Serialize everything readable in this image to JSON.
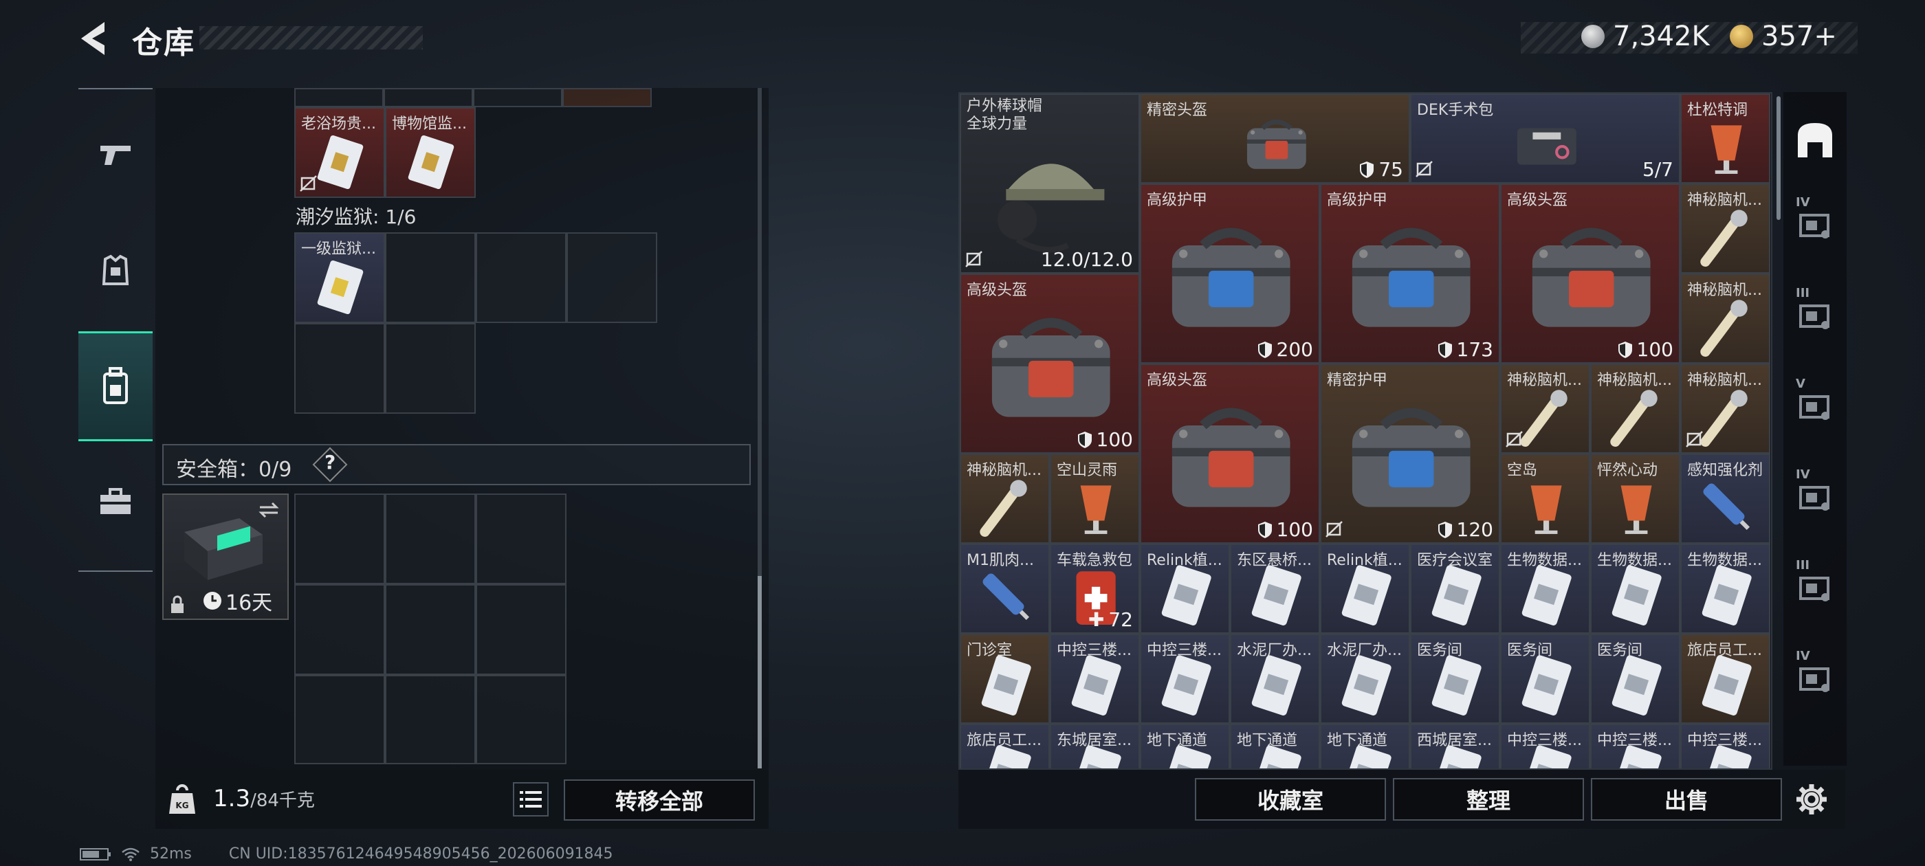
{
  "header": {
    "title": "仓库",
    "currency_silver": "7,342K",
    "currency_gold": "357+"
  },
  "rail": {
    "items": [
      {
        "icon": "gun-icon"
      },
      {
        "icon": "armor-vest-icon"
      },
      {
        "icon": "backpack-icon"
      },
      {
        "icon": "toolbox-icon"
      }
    ]
  },
  "left": {
    "top_items": [
      {
        "name": "老浴场贵...",
        "bg": "red"
      },
      {
        "name": "博物馆监...",
        "bg": "red"
      }
    ],
    "prison_label": "潮汐监狱: 1/6",
    "prison_item": {
      "name": "一级监狱..."
    },
    "safebox_label": "安全箱：0/9",
    "safebox_help": "?",
    "safebox_timer": "16天",
    "weight_value": "1.3",
    "weight_max": "/84千克",
    "transfer_all": "转移全部"
  },
  "stash": {
    "items": [
      {
        "name": "户外棒球帽 全球力量",
        "num": "12.0/12.0",
        "bg": "gray",
        "icon": "cap-headset-icon"
      },
      {
        "name": "精密头盔",
        "num": "75",
        "bg": "brown",
        "icon": "helmet-bag-icon"
      },
      {
        "name": "DEK手术包",
        "num": "5/7",
        "bg": "navy",
        "icon": "surgery-kit-icon"
      },
      {
        "name": "杜松特调",
        "num": "",
        "bg": "red",
        "icon": "drink-icon"
      },
      {
        "name": "高级护甲",
        "num": "200",
        "bg": "red",
        "icon": "armor-bag-icon"
      },
      {
        "name": "高级护甲",
        "num": "173",
        "bg": "red",
        "icon": "armor-bag-icon"
      },
      {
        "name": "高级头盔",
        "num": "100",
        "bg": "red",
        "icon": "helmet-bag-icon"
      },
      {
        "name": "神秘脑机...",
        "num": "",
        "bg": "brown",
        "icon": "brain-chip-icon"
      },
      {
        "name": "高级头盔",
        "num": "100",
        "bg": "red",
        "icon": "helmet-bag-icon"
      },
      {
        "name": "神秘脑机...",
        "num": "",
        "bg": "brown",
        "icon": "brain-chip-icon"
      },
      {
        "name": "高级头盔",
        "num": "100",
        "bg": "red",
        "icon": "helmet-bag-icon"
      },
      {
        "name": "精密护甲",
        "num": "120",
        "bg": "brown",
        "icon": "armor-bag-icon"
      },
      {
        "name": "神秘脑机...",
        "num": "",
        "bg": "brown",
        "icon": "brain-chip-icon"
      },
      {
        "name": "神秘脑机...",
        "num": "",
        "bg": "brown",
        "icon": "brain-chip-icon"
      },
      {
        "name": "神秘脑机...",
        "num": "",
        "bg": "brown",
        "icon": "brain-chip-icon"
      },
      {
        "name": "神秘脑机...",
        "num": "",
        "bg": "brown",
        "icon": "brain-chip-icon"
      },
      {
        "name": "空山灵雨",
        "num": "",
        "bg": "brown",
        "icon": "drink-icon"
      },
      {
        "name": "空岛",
        "num": "",
        "bg": "brown",
        "icon": "drink-icon"
      },
      {
        "name": "怦然心动",
        "num": "",
        "bg": "brown",
        "icon": "drink-icon"
      },
      {
        "name": "感知强化剂",
        "num": "",
        "bg": "navy",
        "icon": "injector-icon"
      },
      {
        "name": "M1肌肉...",
        "num": "",
        "bg": "navy",
        "icon": "injector-icon"
      },
      {
        "name": "车载急救包",
        "num": "72",
        "bg": "navy",
        "icon": "medkit-icon"
      },
      {
        "name": "Relink植...",
        "num": "",
        "bg": "navy",
        "icon": "keycard-icon"
      },
      {
        "name": "东区悬桥...",
        "num": "",
        "bg": "navy",
        "icon": "keycard-icon"
      },
      {
        "name": "Relink植...",
        "num": "",
        "bg": "navy",
        "icon": "keycard-icon"
      },
      {
        "name": "医疗会议室",
        "num": "",
        "bg": "navy",
        "icon": "keycard-icon"
      },
      {
        "name": "生物数据...",
        "num": "",
        "bg": "navy",
        "icon": "keycard-icon"
      },
      {
        "name": "生物数据...",
        "num": "",
        "bg": "navy",
        "icon": "keycard-icon"
      },
      {
        "name": "生物数据...",
        "num": "",
        "bg": "navy",
        "icon": "keycard-icon"
      },
      {
        "name": "门诊室",
        "num": "",
        "bg": "brown",
        "icon": "keycard-icon"
      },
      {
        "name": "中控三楼...",
        "num": "",
        "bg": "navy",
        "icon": "keycard-icon"
      },
      {
        "name": "中控三楼...",
        "num": "",
        "bg": "navy",
        "icon": "keycard-icon"
      },
      {
        "name": "水泥厂办...",
        "num": "",
        "bg": "navy",
        "icon": "keycard-icon"
      },
      {
        "name": "水泥厂办...",
        "num": "",
        "bg": "navy",
        "icon": "keycard-icon"
      },
      {
        "name": "医务间",
        "num": "",
        "bg": "navy",
        "icon": "keycard-icon"
      },
      {
        "name": "医务间",
        "num": "",
        "bg": "navy",
        "icon": "keycard-icon"
      },
      {
        "name": "医务间",
        "num": "",
        "bg": "navy",
        "icon": "keycard-icon"
      },
      {
        "name": "旅店员工...",
        "num": "",
        "bg": "brown",
        "icon": "keycard-icon"
      },
      {
        "name": "旅店员工...",
        "num": "",
        "bg": "navy",
        "icon": "keycard-icon"
      },
      {
        "name": "东城居室...",
        "num": "",
        "bg": "navy",
        "icon": "keycard-icon"
      },
      {
        "name": "地下通道",
        "num": "",
        "bg": "navy",
        "icon": "keycard-icon"
      },
      {
        "name": "地下通道",
        "num": "",
        "bg": "navy",
        "icon": "keycard-icon"
      },
      {
        "name": "地下通道",
        "num": "",
        "bg": "navy",
        "icon": "keycard-icon"
      },
      {
        "name": "西城居室...",
        "num": "",
        "bg": "navy",
        "icon": "keycard-icon"
      },
      {
        "name": "中控三楼...",
        "num": "",
        "bg": "navy",
        "icon": "keycard-icon"
      },
      {
        "name": "中控三楼...",
        "num": "",
        "bg": "navy",
        "icon": "keycard-icon"
      },
      {
        "name": "中控三楼...",
        "num": "",
        "bg": "navy",
        "icon": "keycard-icon"
      }
    ],
    "buttons": {
      "collection": "收藏室",
      "organize": "整理",
      "sell": "出售"
    }
  },
  "right_rail": {
    "tabs": [
      {
        "icon": "stash-home-icon"
      },
      {
        "label": "IV",
        "icon": "tier-4-storage-icon"
      },
      {
        "label": "III",
        "icon": "tier-3-weapon-icon"
      },
      {
        "label": "V",
        "icon": "tier-5-gear-icon"
      },
      {
        "label": "IV",
        "icon": "tier-4-armor-icon"
      },
      {
        "label": "III",
        "icon": "tier-3-tool-icon"
      },
      {
        "label": "IV",
        "icon": "tier-4-parts-icon"
      }
    ]
  },
  "status_bar": {
    "ping": "52ms",
    "uid": "CN UID:183576124649548905456_202606091845"
  },
  "colors": {
    "accent": "#2ee6b0",
    "rarity_red": "#5a2424",
    "rarity_navy": "#34384e",
    "rarity_brown": "#4a3a2c",
    "rarity_gray": "#2c3036"
  }
}
